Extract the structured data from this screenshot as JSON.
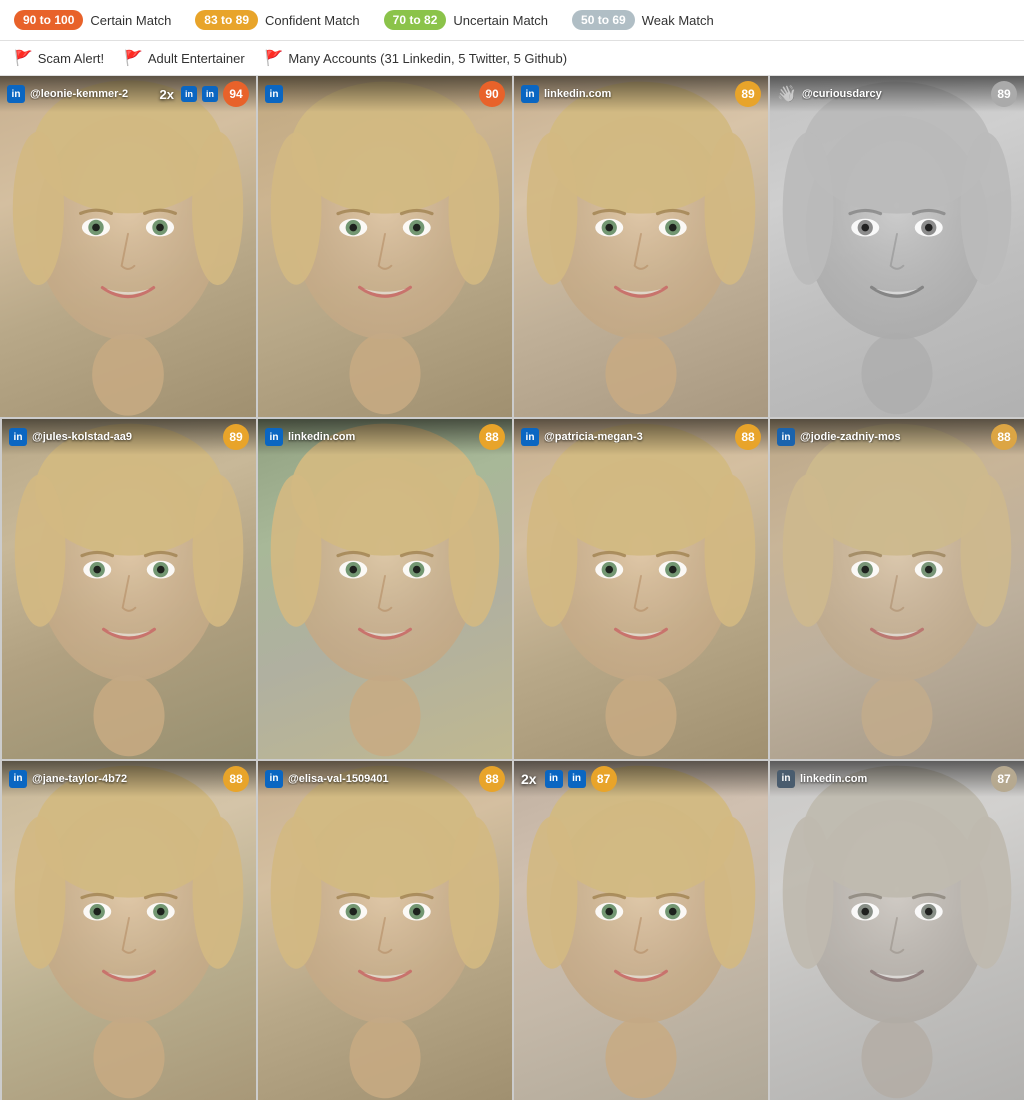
{
  "legend": {
    "items": [
      {
        "id": "certain",
        "range": "90 to 100",
        "label": "Certain Match",
        "badgeClass": "badge-certain"
      },
      {
        "id": "confident",
        "range": "83 to 89",
        "label": "Confident Match",
        "badgeClass": "badge-confident"
      },
      {
        "id": "uncertain",
        "range": "70 to 82",
        "label": "Uncertain Match",
        "badgeClass": "badge-uncertain"
      },
      {
        "id": "weak",
        "range": "50 to 69",
        "label": "Weak Match",
        "badgeClass": "badge-weak"
      }
    ]
  },
  "flags": [
    {
      "icon": "🚩",
      "label": "Scam Alert!"
    },
    {
      "icon": "🚩",
      "label": "Adult Entertainer"
    },
    {
      "icon": "🚩",
      "label": "Many Accounts (31 Linkedin, 5 Twitter, 5 Github)"
    }
  ],
  "cards": [
    {
      "id": 1,
      "platform": "in",
      "username": "@leonie-kemmer-2",
      "score": 94,
      "scoreClass": "certain",
      "faceClass": "face-1",
      "multi": "2x",
      "extraIcons": [
        "in",
        "in"
      ]
    },
    {
      "id": 2,
      "platform": "in",
      "username": "",
      "score": 90,
      "scoreClass": "certain",
      "faceClass": "face-2",
      "multi": null,
      "extraIcons": []
    },
    {
      "id": 3,
      "platform": "in",
      "username": "linkedin.com",
      "score": 89,
      "scoreClass": "confident",
      "faceClass": "face-3",
      "multi": null,
      "extraIcons": []
    },
    {
      "id": 4,
      "platform": "wave",
      "username": "@curiousdarcy",
      "score": 89,
      "scoreClass": "confident",
      "faceClass": "face-4",
      "multi": null,
      "extraIcons": []
    },
    {
      "id": 5,
      "platform": "in",
      "username": "@jules-kolstad-aa9",
      "score": 89,
      "scoreClass": "confident",
      "faceClass": "face-5",
      "multi": null,
      "extraIcons": []
    },
    {
      "id": 6,
      "platform": "in",
      "username": "linkedin.com",
      "score": 88,
      "scoreClass": "confident",
      "faceClass": "face-6",
      "multi": null,
      "extraIcons": []
    },
    {
      "id": 7,
      "platform": "in",
      "username": "@patricia-megan-3",
      "score": 88,
      "scoreClass": "confident",
      "faceClass": "face-7",
      "multi": null,
      "extraIcons": []
    },
    {
      "id": 8,
      "platform": "in",
      "username": "@jodie-zadniy-mos",
      "score": 88,
      "scoreClass": "confident",
      "faceClass": "face-8",
      "multi": null,
      "extraIcons": []
    },
    {
      "id": 9,
      "platform": "in",
      "username": "@jane-taylor-4b72",
      "score": 88,
      "scoreClass": "confident",
      "faceClass": "face-9",
      "multi": null,
      "extraIcons": []
    },
    {
      "id": 10,
      "platform": "in",
      "username": "@elisa-val-1509401",
      "score": 88,
      "scoreClass": "confident",
      "faceClass": "face-10",
      "multi": null,
      "extraIcons": []
    },
    {
      "id": 11,
      "platform": "multi",
      "username": "",
      "score": 87,
      "scoreClass": "confident",
      "faceClass": "face-11",
      "multi": "2x",
      "extraIcons": [
        "in",
        "in"
      ]
    },
    {
      "id": 12,
      "platform": "in",
      "username": "linkedin.com",
      "score": 87,
      "scoreClass": "confident",
      "faceClass": "face-12",
      "multi": null,
      "extraIcons": []
    }
  ]
}
